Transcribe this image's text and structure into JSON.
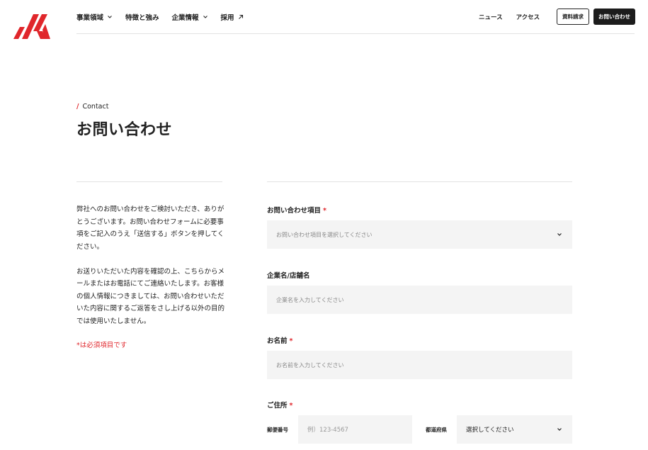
{
  "header": {
    "nav": [
      {
        "label": "事業領域",
        "icon": "chevron-down-icon"
      },
      {
        "label": "特徴と強み",
        "icon": ""
      },
      {
        "label": "企業情報",
        "icon": "chevron-down-icon"
      },
      {
        "label": "採用",
        "icon": "external-arrow-icon"
      }
    ],
    "subnav": [
      "ニュース",
      "アクセス"
    ],
    "doc_button": "資料請求",
    "contact_button": "お問い合わせ"
  },
  "page": {
    "eyebrow": "Contact",
    "title": "お問い合わせ"
  },
  "intro": {
    "paragraph1": "弊社へのお問い合わせをご検討いただき、ありがとうございます。お問い合わせフォームに必要事項をご記入のうえ「送信する」ボタンを押してください。",
    "paragraph2": "お送りいただいた内容を確認の上、こちらからメールまたはお電話にてご連絡いたします。お客様の個人情報につきましては、お問い合わせいただいた内容に関するご返答をさし上げる以外の目的では使用いたしません。",
    "required_note": "*は必須項目です"
  },
  "form": {
    "inquiry": {
      "label": "お問い合わせ項目",
      "required_mark": "*",
      "placeholder": "お問い合わせ項目を選択してください"
    },
    "company": {
      "label": "企業名/店舗名",
      "placeholder": "企業名を入力してください"
    },
    "name": {
      "label": "お名前",
      "required_mark": "*",
      "placeholder": "お名前を入力してください"
    },
    "address": {
      "label": "ご住所",
      "required_mark": "*",
      "zip_label": "郵便番号",
      "zip_placeholder": "例）123-4567",
      "pref_label": "都道府県",
      "pref_value": "選択してください"
    }
  },
  "colors": {
    "accent": "#e0262b",
    "dark": "#1c1c1c",
    "field_bg": "#f4f4f4"
  }
}
